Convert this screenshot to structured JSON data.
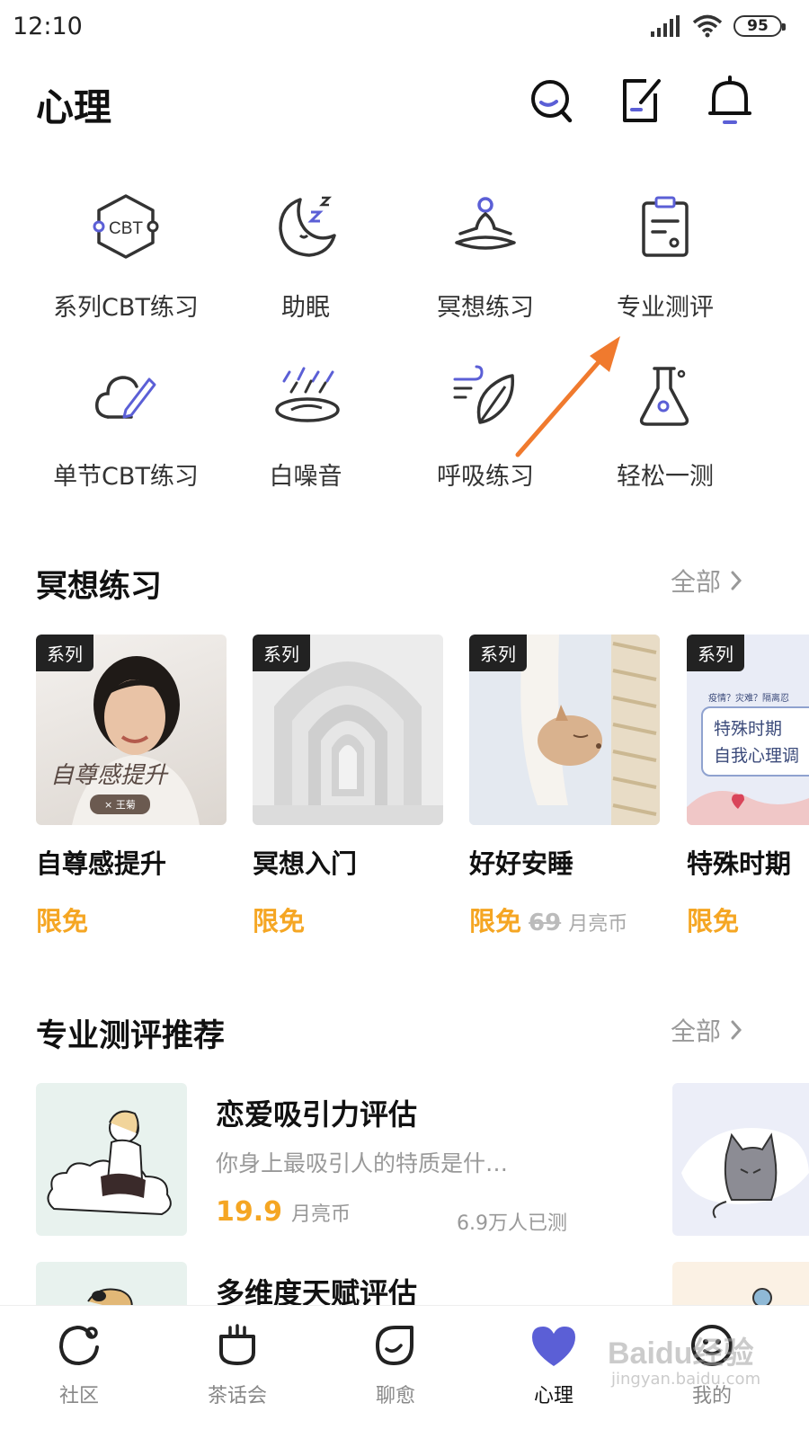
{
  "status": {
    "time": "12:10",
    "battery": "95"
  },
  "header": {
    "title": "心理"
  },
  "grid": [
    {
      "label": "系列CBT练习",
      "icon": "cbt-hexagon-icon"
    },
    {
      "label": "助眠",
      "icon": "moon-sleep-icon"
    },
    {
      "label": "冥想练习",
      "icon": "meditation-icon"
    },
    {
      "label": "专业测评",
      "icon": "clipboard-icon"
    },
    {
      "label": "单节CBT练习",
      "icon": "cloud-pencil-icon"
    },
    {
      "label": "白噪音",
      "icon": "rain-icon"
    },
    {
      "label": "呼吸练习",
      "icon": "leaf-wind-icon"
    },
    {
      "label": "轻松一测",
      "icon": "flask-icon"
    }
  ],
  "meditation": {
    "title": "冥想练习",
    "see_all": "全部",
    "cards": [
      {
        "badge": "系列",
        "title": "自尊感提升",
        "price": "限免",
        "cover_text": "自尊感提升",
        "cover_sub": "× 王菊"
      },
      {
        "badge": "系列",
        "title": "冥想入门",
        "price": "限免"
      },
      {
        "badge": "系列",
        "title": "好好安睡",
        "price": "限免",
        "original": "69",
        "unit": "月亮币"
      },
      {
        "badge": "系列",
        "title": "特殊时期",
        "price": "限免",
        "cover_small": "疫情？灾难？隔离忍",
        "cover_line1": "特殊时期",
        "cover_line2": "自我心理调"
      }
    ]
  },
  "evaluation": {
    "title": "专业测评推荐",
    "see_all": "全部",
    "items": [
      {
        "title": "恋爱吸引力评估",
        "desc": "你身上最吸引人的特质是什…",
        "price": "19.9",
        "unit": "月亮币",
        "count": "6.9万人已测"
      },
      {
        "title": "多维度天赋评估"
      }
    ]
  },
  "tabs": [
    {
      "label": "社区"
    },
    {
      "label": "茶话会"
    },
    {
      "label": "聊愈"
    },
    {
      "label": "心理"
    },
    {
      "label": "我的"
    }
  ],
  "watermark": {
    "text": "Baidu经验",
    "sub": "jingyan.baidu.com"
  },
  "colors": {
    "accent": "#5b5fd6",
    "price": "#f5a623",
    "arrow": "#f07a2e"
  }
}
